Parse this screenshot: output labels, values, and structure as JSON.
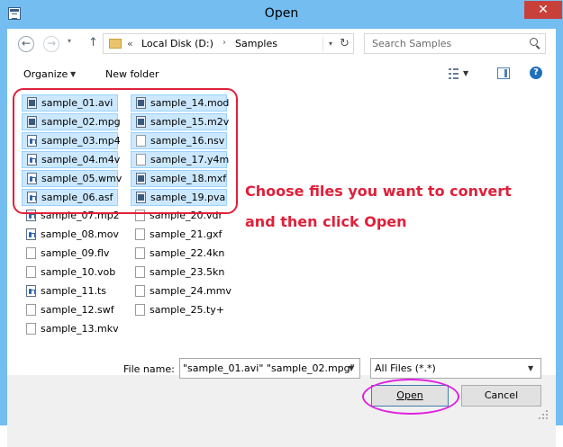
{
  "window": {
    "title": "Open",
    "close_glyph": "✕"
  },
  "nav": {
    "back_glyph": "←",
    "forward_glyph": "→",
    "dropdown_glyph": "▾",
    "up_glyph": "↑",
    "address_chevron": "«",
    "address_drive": "Local Disk (D:)",
    "address_separator": "›",
    "address_folder": "Samples",
    "address_dropdown_glyph": "▾",
    "refresh_glyph": "↻",
    "search_placeholder": "Search Samples"
  },
  "toolbar": {
    "organize_label": "Organize",
    "organize_dropdown_glyph": "▼",
    "new_folder_label": "New folder",
    "view_dropdown_glyph": "▼",
    "help_glyph": "?"
  },
  "files": [
    {
      "name": "sample_01.avi",
      "selected": true,
      "icon": "media"
    },
    {
      "name": "sample_02.mpg",
      "selected": true,
      "icon": "media"
    },
    {
      "name": "sample_03.mp4",
      "selected": true,
      "icon": "audio"
    },
    {
      "name": "sample_04.m4v",
      "selected": true,
      "icon": "audio"
    },
    {
      "name": "sample_05.wmv",
      "selected": true,
      "icon": "audio"
    },
    {
      "name": "sample_06.asf",
      "selected": true,
      "icon": "audio"
    },
    {
      "name": "sample_07.mp2",
      "selected": false,
      "icon": "audio"
    },
    {
      "name": "sample_08.mov",
      "selected": false,
      "icon": "audio"
    },
    {
      "name": "sample_09.flv",
      "selected": false,
      "icon": "blank"
    },
    {
      "name": "sample_10.vob",
      "selected": false,
      "icon": "blank"
    },
    {
      "name": "sample_11.ts",
      "selected": false,
      "icon": "audio"
    },
    {
      "name": "sample_12.swf",
      "selected": false,
      "icon": "blank"
    },
    {
      "name": "sample_13.mkv",
      "selected": false,
      "icon": "blank"
    },
    {
      "name": "sample_14.mod",
      "selected": true,
      "icon": "media"
    },
    {
      "name": "sample_15.m2v",
      "selected": true,
      "icon": "media"
    },
    {
      "name": "sample_16.nsv",
      "selected": true,
      "icon": "blank"
    },
    {
      "name": "sample_17.y4m",
      "selected": true,
      "icon": "blank"
    },
    {
      "name": "sample_18.mxf",
      "selected": true,
      "icon": "media"
    },
    {
      "name": "sample_19.pva",
      "selected": true,
      "icon": "media"
    },
    {
      "name": "sample_20.vdr",
      "selected": false,
      "icon": "blank"
    },
    {
      "name": "sample_21.gxf",
      "selected": false,
      "icon": "blank"
    },
    {
      "name": "sample_22.4kn",
      "selected": false,
      "icon": "blank"
    },
    {
      "name": "sample_23.5kn",
      "selected": false,
      "icon": "blank"
    },
    {
      "name": "sample_24.mmv",
      "selected": false,
      "icon": "blank"
    },
    {
      "name": "sample_25.ty+",
      "selected": false,
      "icon": "blank"
    }
  ],
  "annotation": {
    "line1": "Choose files you want to convert",
    "line2": "and then click Open",
    "color": "#e0203a",
    "highlight_color": "#e020e0"
  },
  "bottom": {
    "file_name_label": "File name:",
    "file_name_value": "\"sample_01.avi\" \"sample_02.mpg\"",
    "file_name_dropdown_glyph": "▼",
    "filter_value": "All Files (*.*)",
    "filter_dropdown_glyph": "▼",
    "open_label": "Open",
    "cancel_label": "Cancel"
  },
  "colors": {
    "window_frame": "#73bdf0",
    "close_button": "#c7413a",
    "selection_fill": "#cce8ff",
    "selection_border": "#99d1ff"
  }
}
